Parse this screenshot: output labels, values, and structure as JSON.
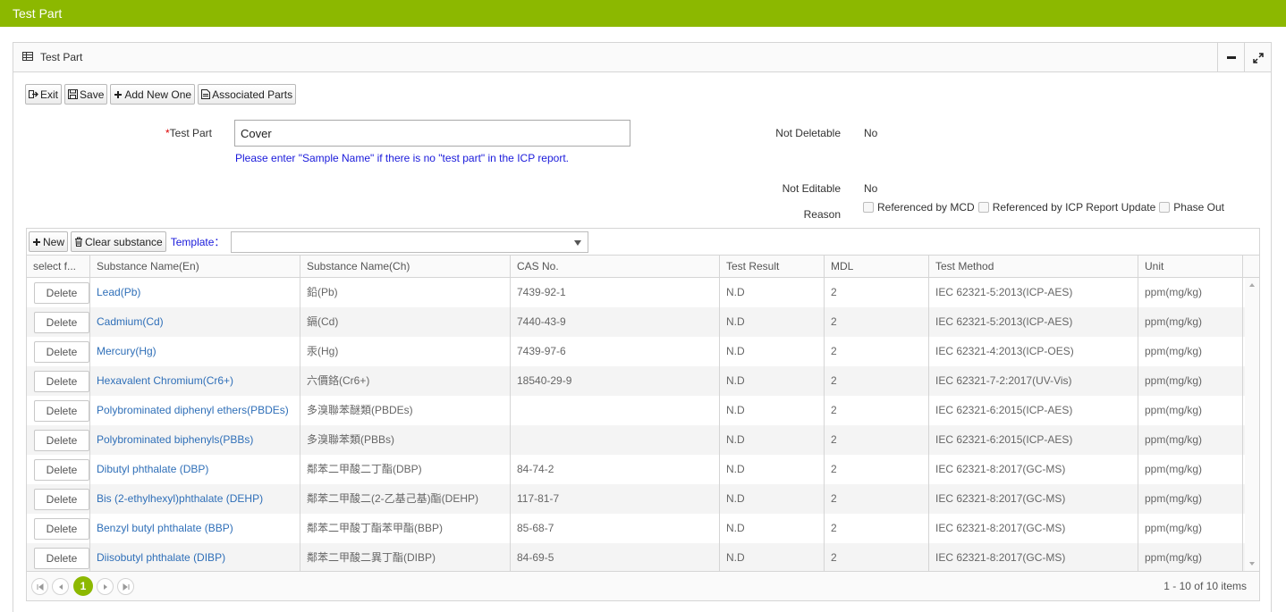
{
  "app": {
    "title": "Test Part"
  },
  "panel": {
    "title": "Test Part"
  },
  "toolbar": {
    "exit_label": "Exit",
    "save_label": "Save",
    "add_new_label": "Add New One",
    "associated_label": "Associated Parts"
  },
  "form": {
    "test_part_required": "*",
    "test_part_label": "Test Part",
    "test_part_value": "Cover",
    "hint": "Please enter \"Sample Name\" if there is no \"test part\" in the ICP report.",
    "not_deletable_label": "Not Deletable",
    "not_deletable_value": "No",
    "not_editable_label": "Not Editable",
    "not_editable_value": "No",
    "reason_label": "Reason",
    "reasons": [
      "Referenced by MCD",
      "Referenced by ICP Report Update",
      "Phase Out"
    ]
  },
  "grid": {
    "new_label": "New",
    "clear_label": "Clear substance",
    "template_label": "Template：",
    "template_value": "",
    "columns": [
      "select f...",
      "Substance Name(En)",
      "Substance Name(Ch)",
      "CAS No.",
      "Test Result",
      "MDL",
      "Test Method",
      "Unit"
    ],
    "delete_label": "Delete",
    "rows": [
      {
        "en": "Lead(Pb)",
        "ch": "鉛(Pb)",
        "cas": "7439-92-1",
        "result": "N.D",
        "mdl": "2",
        "method": "IEC 62321-5:2013(ICP-AES)",
        "unit": "ppm(mg/kg)"
      },
      {
        "en": "Cadmium(Cd)",
        "ch": "鎘(Cd)",
        "cas": "7440-43-9",
        "result": "N.D",
        "mdl": "2",
        "method": "IEC 62321-5:2013(ICP-AES)",
        "unit": "ppm(mg/kg)"
      },
      {
        "en": "Mercury(Hg)",
        "ch": "汞(Hg)",
        "cas": "7439-97-6",
        "result": "N.D",
        "mdl": "2",
        "method": "IEC 62321-4:2013(ICP-OES)",
        "unit": "ppm(mg/kg)"
      },
      {
        "en": "Hexavalent Chromium(Cr6+)",
        "ch": "六價鉻(Cr6+)",
        "cas": "18540-29-9",
        "result": "N.D",
        "mdl": "2",
        "method": "IEC 62321-7-2:2017(UV-Vis)",
        "unit": "ppm(mg/kg)"
      },
      {
        "en": "Polybrominated diphenyl ethers(PBDEs)",
        "ch": "多溴聯苯醚類(PBDEs)",
        "cas": "",
        "result": "N.D",
        "mdl": "2",
        "method": "IEC 62321-6:2015(ICP-AES)",
        "unit": "ppm(mg/kg)"
      },
      {
        "en": "Polybrominated biphenyls(PBBs)",
        "ch": "多溴聯苯類(PBBs)",
        "cas": "",
        "result": "N.D",
        "mdl": "2",
        "method": "IEC 62321-6:2015(ICP-AES)",
        "unit": "ppm(mg/kg)"
      },
      {
        "en": "Dibutyl phthalate (DBP)",
        "ch": "鄰苯二甲酸二丁酯(DBP)",
        "cas": "84-74-2",
        "result": "N.D",
        "mdl": "2",
        "method": "IEC 62321-8:2017(GC-MS)",
        "unit": "ppm(mg/kg)"
      },
      {
        "en": "Bis (2-ethylhexyl)phthalate (DEHP)",
        "ch": "鄰苯二甲酸二(2-乙基己基)酯(DEHP)",
        "cas": "117-81-7",
        "result": "N.D",
        "mdl": "2",
        "method": "IEC 62321-8:2017(GC-MS)",
        "unit": "ppm(mg/kg)"
      },
      {
        "en": "Benzyl butyl phthalate (BBP)",
        "ch": "鄰苯二甲酸丁酯苯甲酯(BBP)",
        "cas": "85-68-7",
        "result": "N.D",
        "mdl": "2",
        "method": "IEC 62321-8:2017(GC-MS)",
        "unit": "ppm(mg/kg)"
      },
      {
        "en": "Diisobutyl phthalate (DIBP)",
        "ch": "鄰苯二甲酸二異丁酯(DIBP)",
        "cas": "84-69-5",
        "result": "N.D",
        "mdl": "2",
        "method": "IEC 62321-8:2017(GC-MS)",
        "unit": "ppm(mg/kg)"
      }
    ],
    "pager": {
      "current_page": "1",
      "info": "1 - 10 of 10 items"
    }
  },
  "colors": {
    "brand": "#8cb800",
    "link": "#2f6fb8",
    "hint": "#1a1adb",
    "required": "#dd0000"
  }
}
